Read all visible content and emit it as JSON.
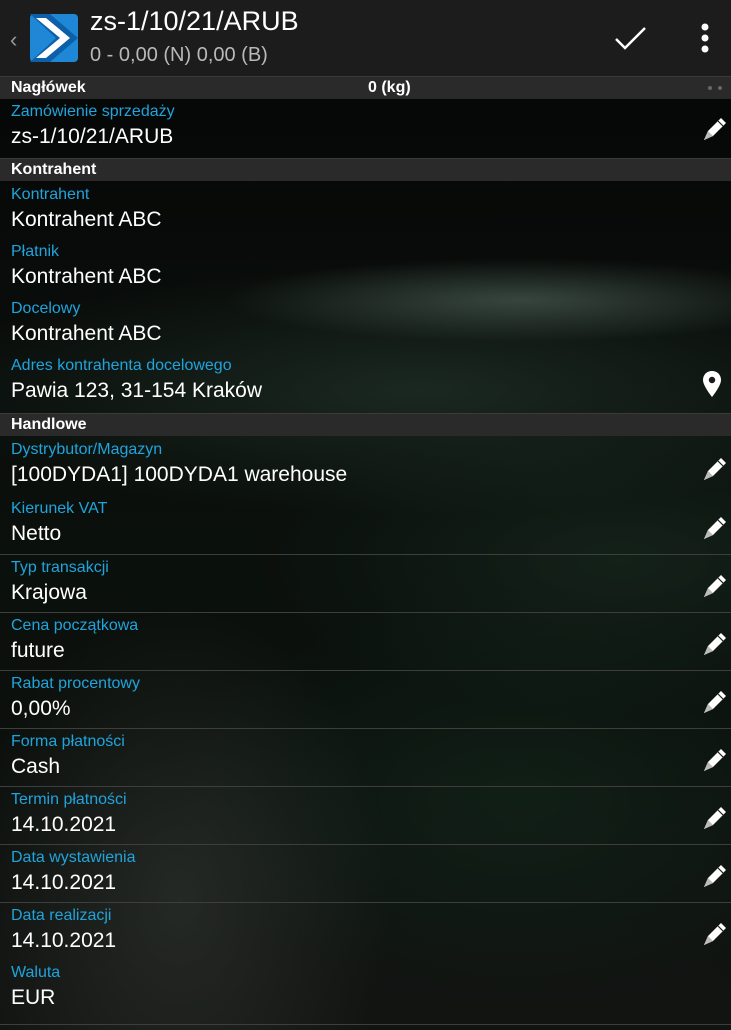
{
  "header": {
    "title": "zs-1/10/21/ARUB",
    "subtitle": "0 - 0,00 (N) 0,00 (B)",
    "back_icon": "chevron-left-icon",
    "logo_icon": "app-logo-icon",
    "confirm_icon": "check-icon",
    "menu_icon": "more-vert-icon"
  },
  "sections": {
    "naglowek": {
      "label": "Nagłówek",
      "weight": "0 (kg)"
    },
    "kontrahent": {
      "label": "Kontrahent"
    },
    "handlowe": {
      "label": "Handlowe"
    }
  },
  "fields": {
    "zamowienie": {
      "label": "Zamówienie sprzedaży",
      "value": "zs-1/10/21/ARUB"
    },
    "kontrahent": {
      "label": "Kontrahent",
      "value": "Kontrahent ABC"
    },
    "platnik": {
      "label": "Płatnik",
      "value": "Kontrahent ABC"
    },
    "docelowy": {
      "label": "Docelowy",
      "value": "Kontrahent ABC"
    },
    "adres": {
      "label": "Adres kontrahenta docelowego",
      "value": "Pawia 123, 31-154 Kraków"
    },
    "dystrybutor": {
      "label": "Dystrybutor/Magazyn",
      "value": "[100DYDA1] 100DYDA1 warehouse"
    },
    "kierunek_vat": {
      "label": "Kierunek VAT",
      "value": "Netto"
    },
    "typ_transakcji": {
      "label": "Typ transakcji",
      "value": "Krajowa"
    },
    "cena_poczatkowa": {
      "label": "Cena początkowa",
      "value": "future"
    },
    "rabat": {
      "label": "Rabat procentowy",
      "value": "0,00%"
    },
    "forma_platnosci": {
      "label": "Forma płatności",
      "value": "Cash"
    },
    "termin_platnosci": {
      "label": "Termin płatności",
      "value": "14.10.2021"
    },
    "data_wystawienia": {
      "label": "Data wystawienia",
      "value": "14.10.2021"
    },
    "data_realizacji": {
      "label": "Data realizacji",
      "value": "14.10.2021"
    },
    "waluta": {
      "label": "Waluta",
      "value": "EUR"
    }
  },
  "colors": {
    "accent": "#1fa4dc",
    "header_bg": "#1c1c1c",
    "section_bg": "#2a2a2a",
    "logo_blue": "#1e88d6"
  }
}
